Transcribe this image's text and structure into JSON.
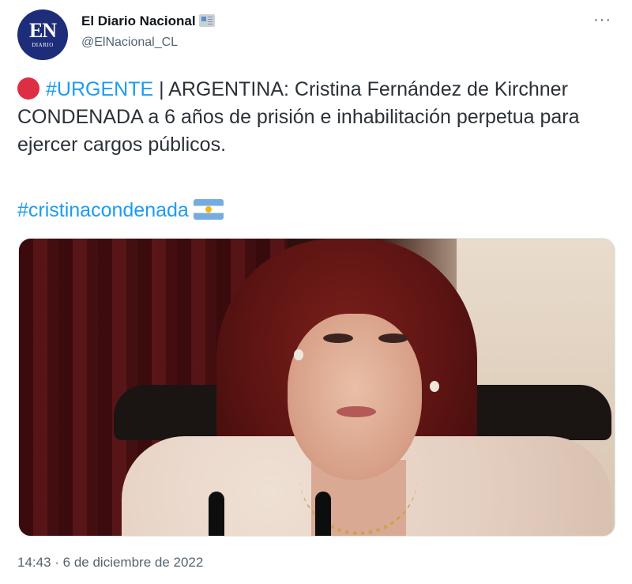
{
  "author": {
    "avatar_text": "EN",
    "avatar_subtext": "DIARIO",
    "name": "El Diario Nacional",
    "handle": "@ElNacional_CL"
  },
  "more_label": "···",
  "tweet": {
    "hashtag_urgent": "#URGENTE",
    "separator": " | ",
    "text_part1": "ARGENTINA: Cristina Fernández de Kirchner ",
    "text_condemned": "CONDENADA",
    "text_part2": " a 6 años de prisión e inhabilitación perpetua para ejercer cargos públicos.",
    "hashtag_topic": "#cristinacondenada"
  },
  "icons": {
    "red_circle": "red-circle-emoji",
    "flag": "argentina-flag-emoji",
    "news": "newspaper-emoji"
  },
  "timestamp": "14:43 · 6 de diciembre de 2022"
}
